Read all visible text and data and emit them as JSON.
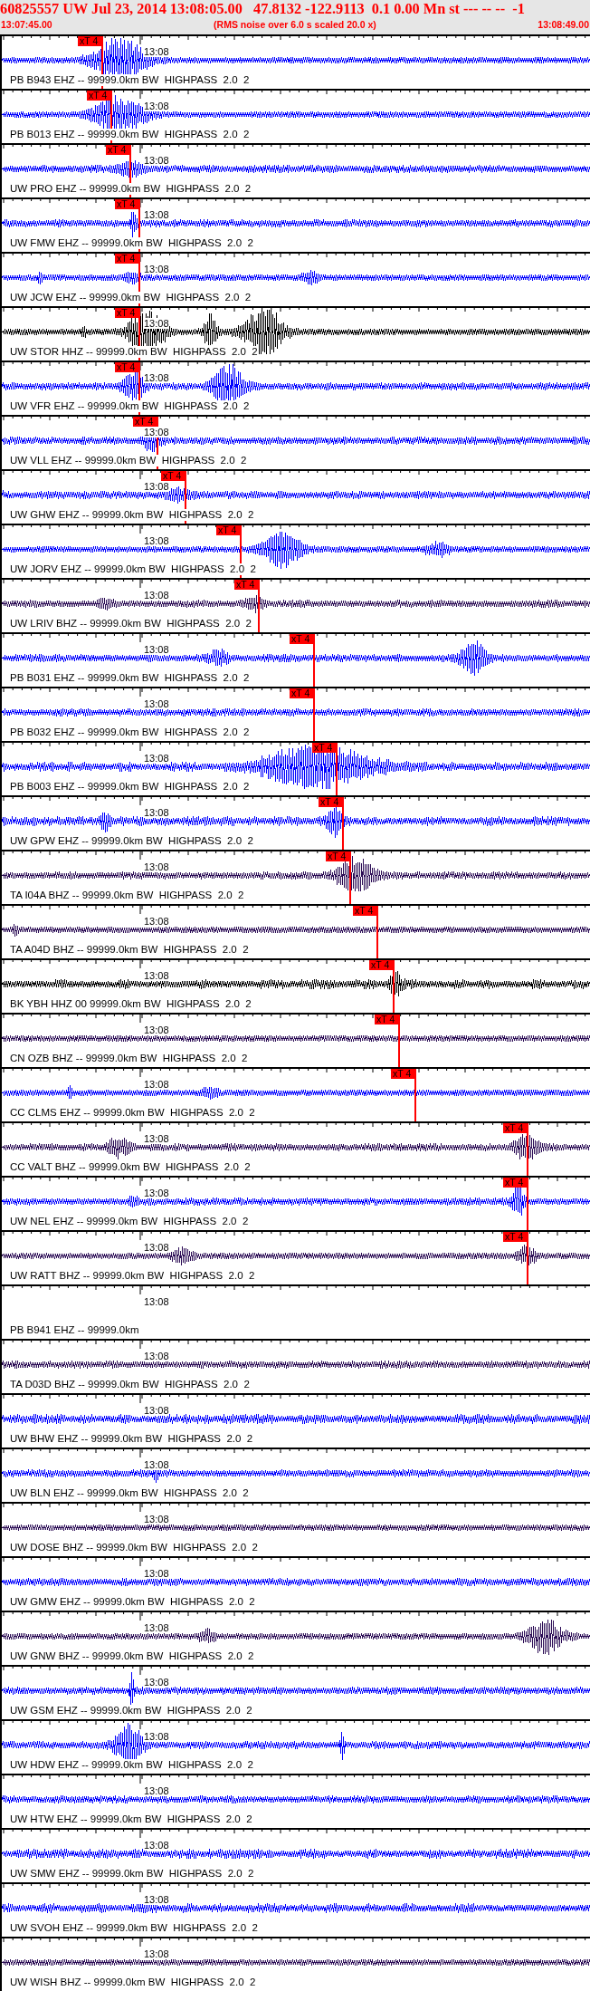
{
  "header": {
    "title": "60825557 UW Jul 23, 2014 13:08:05.00   47.8132 -122.9113  0.1 0.00 Mn st --- -- --  -1",
    "start_time": "13:07:45.00",
    "note": "(RMS noise over 6.0 s scaled 20.0 x)",
    "end_time": "13:08:49.00"
  },
  "traces": [
    {
      "label": "PB B943 EHZ -- 99999.0km BW  HIGHPASS  2.0  2",
      "time_label": "13:08",
      "color": "#0000ff",
      "pick": "xT 4"
    },
    {
      "label": "PB B013 EHZ -- 99999.0km BW  HIGHPASS  2.0  2",
      "time_label": "13:08",
      "color": "#0000ff",
      "pick": "xT 4"
    },
    {
      "label": "UW PRO EHZ -- 99999.0km BW  HIGHPASS  2.0  2",
      "time_label": "13:08",
      "color": "#0000ff",
      "pick": "xT 4"
    },
    {
      "label": "UW FMW EHZ -- 99999.0km BW  HIGHPASS  2.0  2",
      "time_label": "13:08",
      "color": "#0000ff",
      "pick": "xT 4"
    },
    {
      "label": "UW JCW EHZ -- 99999.0km BW  HIGHPASS  2.0  2",
      "time_label": "13:08",
      "color": "#0000ff",
      "pick": "xT 4"
    },
    {
      "label": "UW STOR HHZ -- 99999.0km BW  HIGHPASS  2.0  2",
      "time_label": "13:08",
      "color": "#000000",
      "pick": "xT 4"
    },
    {
      "label": "UW VFR EHZ -- 99999.0km BW  HIGHPASS  2.0  2",
      "time_label": "13:08",
      "color": "#0000ff",
      "pick": "xT 4"
    },
    {
      "label": "UW VLL EHZ -- 99999.0km BW  HIGHPASS  2.0  2",
      "time_label": "13:08",
      "color": "#0000ff",
      "pick": "xT 4"
    },
    {
      "label": "UW GHW EHZ -- 99999.0km BW  HIGHPASS  2.0  2",
      "time_label": "13:08",
      "color": "#0000ff",
      "pick": "xT 4"
    },
    {
      "label": "UW JORV EHZ -- 99999.0km BW  HIGHPASS  2.0  2",
      "time_label": "13:08",
      "color": "#0000ff",
      "pick": "xT 4"
    },
    {
      "label": "UW LRIV BHZ -- 99999.0km BW  HIGHPASS  2.0  2",
      "time_label": "13:08",
      "color": "#2b0c55",
      "pick": "xT 4"
    },
    {
      "label": "PB B031 EHZ -- 99999.0km BW  HIGHPASS  2.0  2",
      "time_label": "13:08",
      "color": "#0000ff",
      "pick": "xT 4"
    },
    {
      "label": "PB B032 EHZ -- 99999.0km BW  HIGHPASS  2.0  2",
      "time_label": "13:08",
      "color": "#0000ff",
      "pick": "xT 4"
    },
    {
      "label": "PB B003 EHZ -- 99999.0km BW  HIGHPASS  2.0  2",
      "time_label": "13:08",
      "color": "#0000ff",
      "pick": "xT 4"
    },
    {
      "label": "UW GPW EHZ -- 99999.0km BW  HIGHPASS  2.0  2",
      "time_label": "13:08",
      "color": "#0000ff",
      "pick": "xT 4"
    },
    {
      "label": "TA I04A BHZ -- 99999.0km BW  HIGHPASS  2.0  2",
      "time_label": "13:08",
      "color": "#2b0c55",
      "pick": "xT 4"
    },
    {
      "label": "TA A04D BHZ -- 99999.0km BW  HIGHPASS  2.0  2",
      "time_label": "13:08",
      "color": "#2b0c55",
      "pick": "xT 4"
    },
    {
      "label": "BK YBH HHZ 00 99999.0km BW  HIGHPASS  2.0  2",
      "time_label": "13:08",
      "color": "#000000",
      "pick": "xT 4"
    },
    {
      "label": "CN OZB BHZ -- 99999.0km BW  HIGHPASS  2.0  2",
      "time_label": "13:08",
      "color": "#2b0c55",
      "pick": "xT 4"
    },
    {
      "label": "CC CLMS EHZ -- 99999.0km BW  HIGHPASS  2.0  2",
      "time_label": "13:08",
      "color": "#0000ff",
      "pick": "xT 4"
    },
    {
      "label": "CC VALT BHZ -- 99999.0km BW  HIGHPASS  2.0  2",
      "time_label": "13:08",
      "color": "#2b0c55",
      "pick": "xT 4"
    },
    {
      "label": "UW NEL EHZ -- 99999.0km BW  HIGHPASS  2.0  2",
      "time_label": "13:08",
      "color": "#0000ff",
      "pick": "xT 4"
    },
    {
      "label": "UW RATT BHZ -- 99999.0km BW  HIGHPASS  2.0  2",
      "time_label": "13:08",
      "color": "#2b0c55",
      "pick": "xT 4"
    },
    {
      "label": "PB B941 EHZ -- 99999.0km",
      "time_label": "13:08"
    },
    {
      "label": "TA D03D BHZ -- 99999.0km BW  HIGHPASS  2.0  2",
      "time_label": "13:08",
      "color": "#2b0c55"
    },
    {
      "label": "UW BHW EHZ -- 99999.0km BW  HIGHPASS  2.0  2",
      "time_label": "13:08",
      "color": "#0000ff"
    },
    {
      "label": "UW BLN EHZ -- 99999.0km BW  HIGHPASS  2.0  2",
      "time_label": "13:08",
      "color": "#0000ff"
    },
    {
      "label": "UW DOSE BHZ -- 99999.0km BW  HIGHPASS  2.0  2",
      "time_label": "13:08",
      "color": "#2b0c55"
    },
    {
      "label": "UW GMW EHZ -- 99999.0km BW  HIGHPASS  2.0  2",
      "time_label": "13:08",
      "color": "#0000ff"
    },
    {
      "label": "UW GNW BHZ -- 99999.0km BW  HIGHPASS  2.0  2",
      "time_label": "13:08",
      "color": "#2b0c55"
    },
    {
      "label": "UW GSM EHZ -- 99999.0km BW  HIGHPASS  2.0  2",
      "time_label": "13:08",
      "color": "#0000ff"
    },
    {
      "label": "UW HDW EHZ -- 99999.0km BW  HIGHPASS  2.0  2",
      "time_label": "13:08",
      "color": "#0000ff"
    },
    {
      "label": "UW HTW EHZ -- 99999.0km BW  HIGHPASS  2.0  2",
      "time_label": "13:08",
      "color": "#0000ff"
    },
    {
      "label": "UW SMW EHZ -- 99999.0km BW  HIGHPASS  2.0  2",
      "time_label": "13:08",
      "color": "#0000ff"
    },
    {
      "label": "UW SVOH EHZ -- 99999.0km BW  HIGHPASS  2.0  2",
      "time_label": "13:08",
      "color": "#0000ff"
    },
    {
      "label": "UW WISH BHZ -- 99999.0km BW  HIGHPASS  2.0  2",
      "time_label": "13:08",
      "color": "#2b0c55"
    }
  ]
}
